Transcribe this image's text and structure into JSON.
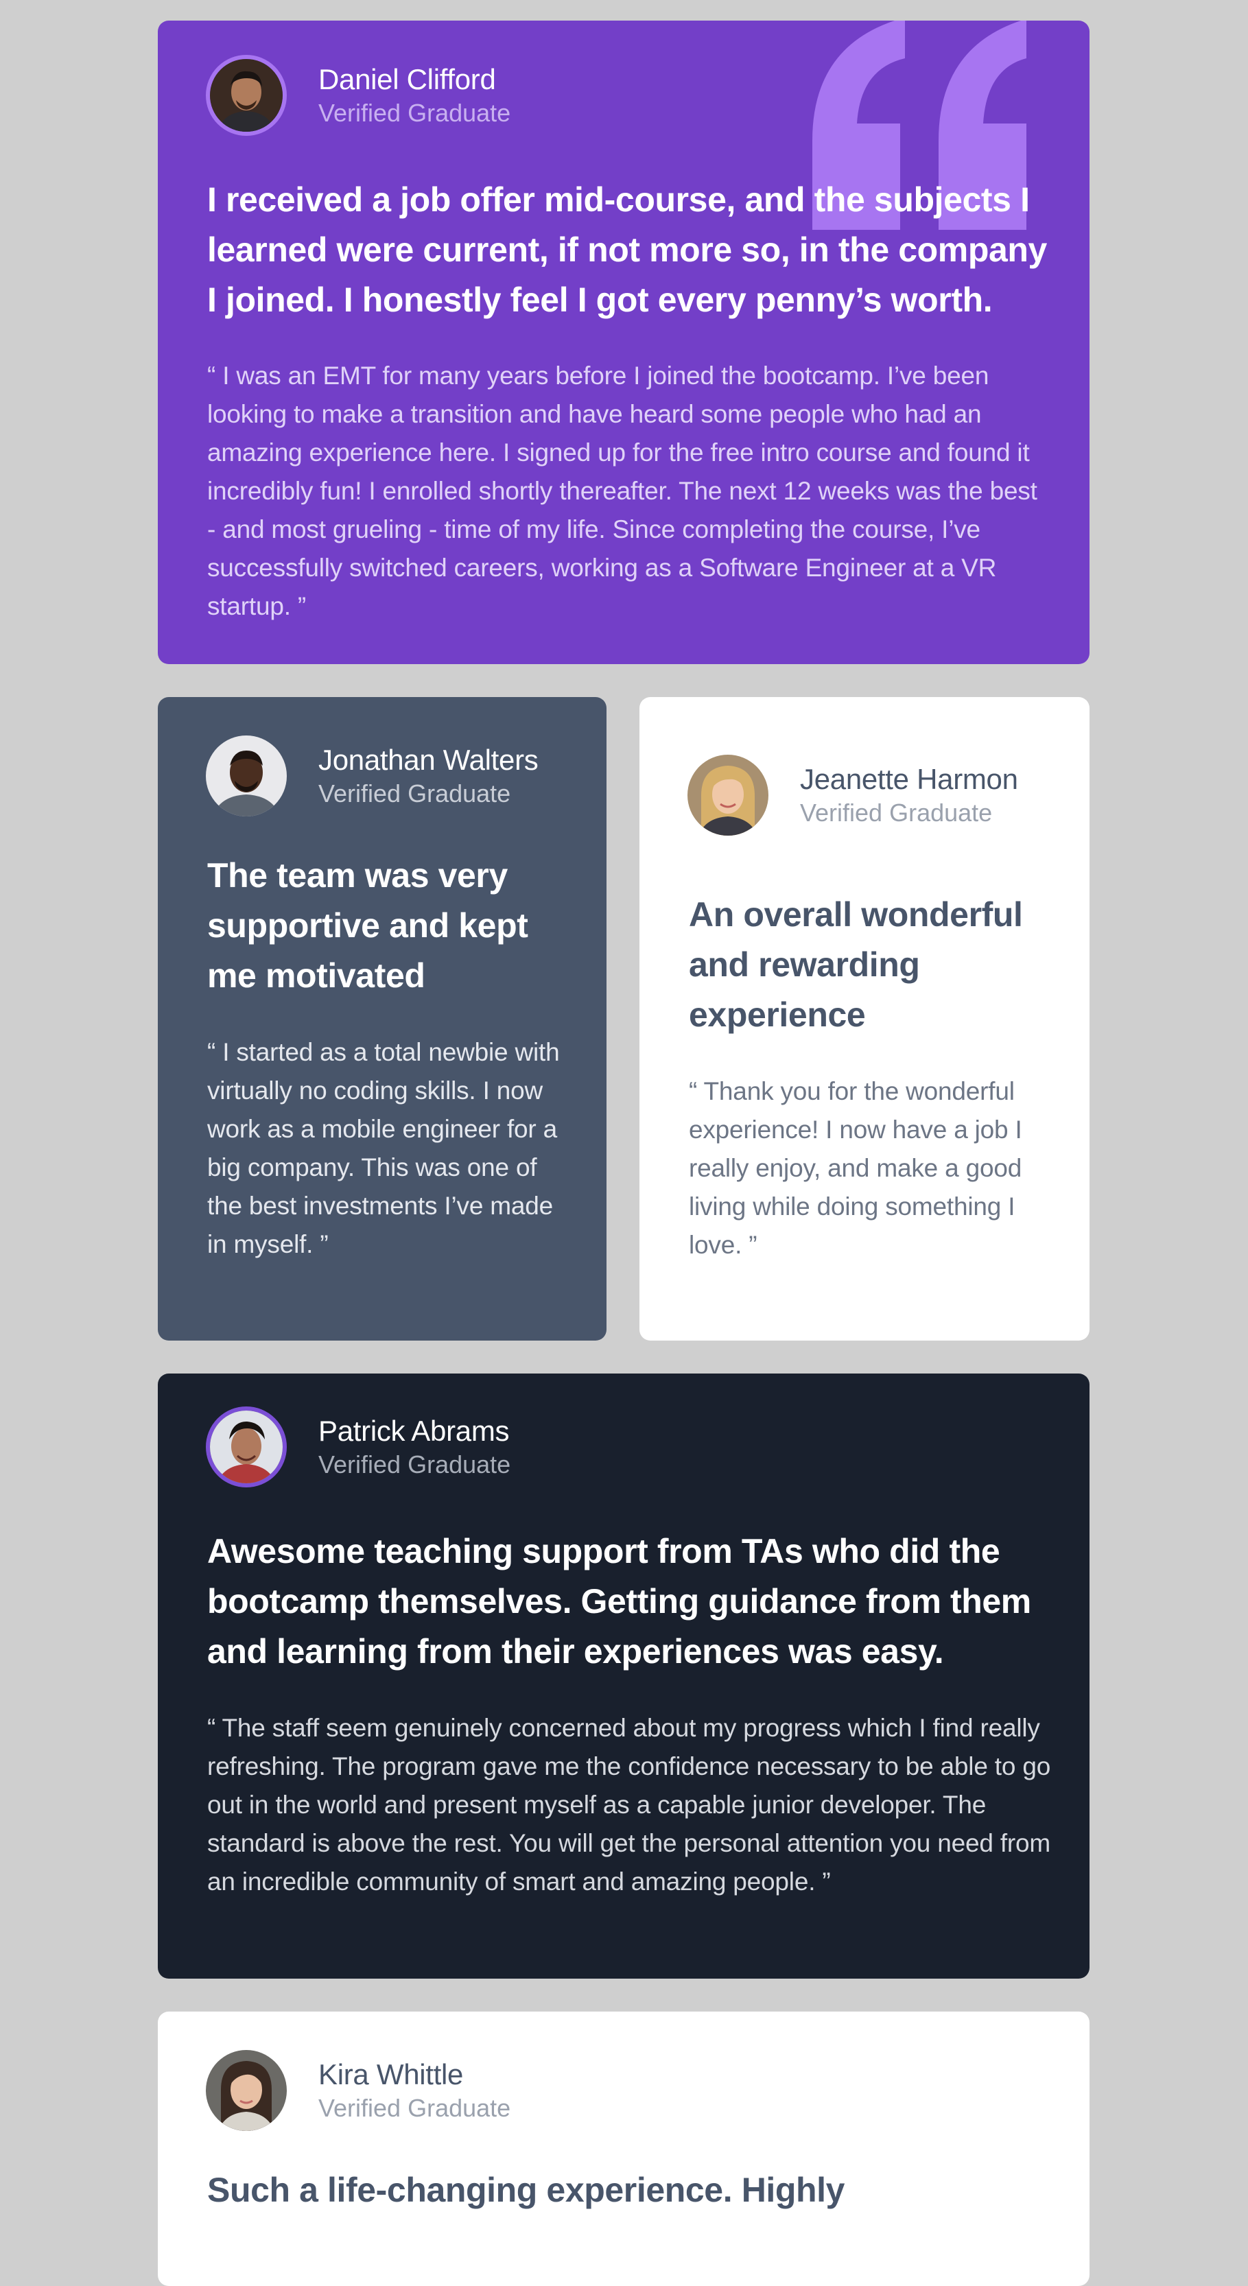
{
  "colors": {
    "page_background": "#cfcfcf",
    "card_purple": "#733fc8",
    "card_slate": "#48556a",
    "card_white": "#ffffff",
    "card_dark": "#19202d",
    "quote_mark": "#a775f1"
  },
  "testimonials": [
    {
      "name": "Daniel Clifford",
      "role": "Verified Graduate",
      "headline": "I received a job offer mid-course, and the subjects I learned were current, if not more so, in the company I joined. I honestly feel I got every penny’s worth.",
      "quote": "“ I was an EMT for many years before I joined the bootcamp. I’ve been looking to make a transition and have heard some people who had an amazing experience here. I signed up for the free intro course and found it incredibly fun! I enrolled shortly thereafter. The next 12 weeks was the best - and most grueling - time of my life. Since completing the course, I’ve successfully switched careers, working as a Software Engineer at a VR startup. ”",
      "avatar_icon": "avatar-daniel-icon"
    },
    {
      "name": "Jonathan Walters",
      "role": "Verified Graduate",
      "headline": "The team was very supportive and kept me motivated",
      "quote": "“ I started as a total newbie with virtually no coding skills. I now work as a mobile engineer for a big company. This was one of the best investments I’ve made in myself. ”",
      "avatar_icon": "avatar-jonathan-icon"
    },
    {
      "name": "Jeanette Harmon",
      "role": "Verified Graduate",
      "headline": "An overall wonderful and rewarding experience",
      "quote": "“ Thank you for the wonderful experience! I now have a job I really enjoy, and make a good living while doing something I love. ”",
      "avatar_icon": "avatar-jeanette-icon"
    },
    {
      "name": "Patrick Abrams",
      "role": "Verified Graduate",
      "headline": "Awesome teaching support from TAs who did the bootcamp themselves. Getting guidance from them and learning from their experiences was easy.",
      "quote": "“ The staff seem genuinely concerned about my progress which I find really refreshing. The program gave me the confidence necessary to be able to go out in the world and present myself as a capable junior developer. The standard is above the rest. You will get the personal attention you need from an incredible community of smart and amazing people. ”",
      "avatar_icon": "avatar-patrick-icon"
    },
    {
      "name": "Kira Whittle",
      "role": "Verified Graduate",
      "headline": "Such a life-changing experience. Highly",
      "avatar_icon": "avatar-kira-icon"
    }
  ]
}
